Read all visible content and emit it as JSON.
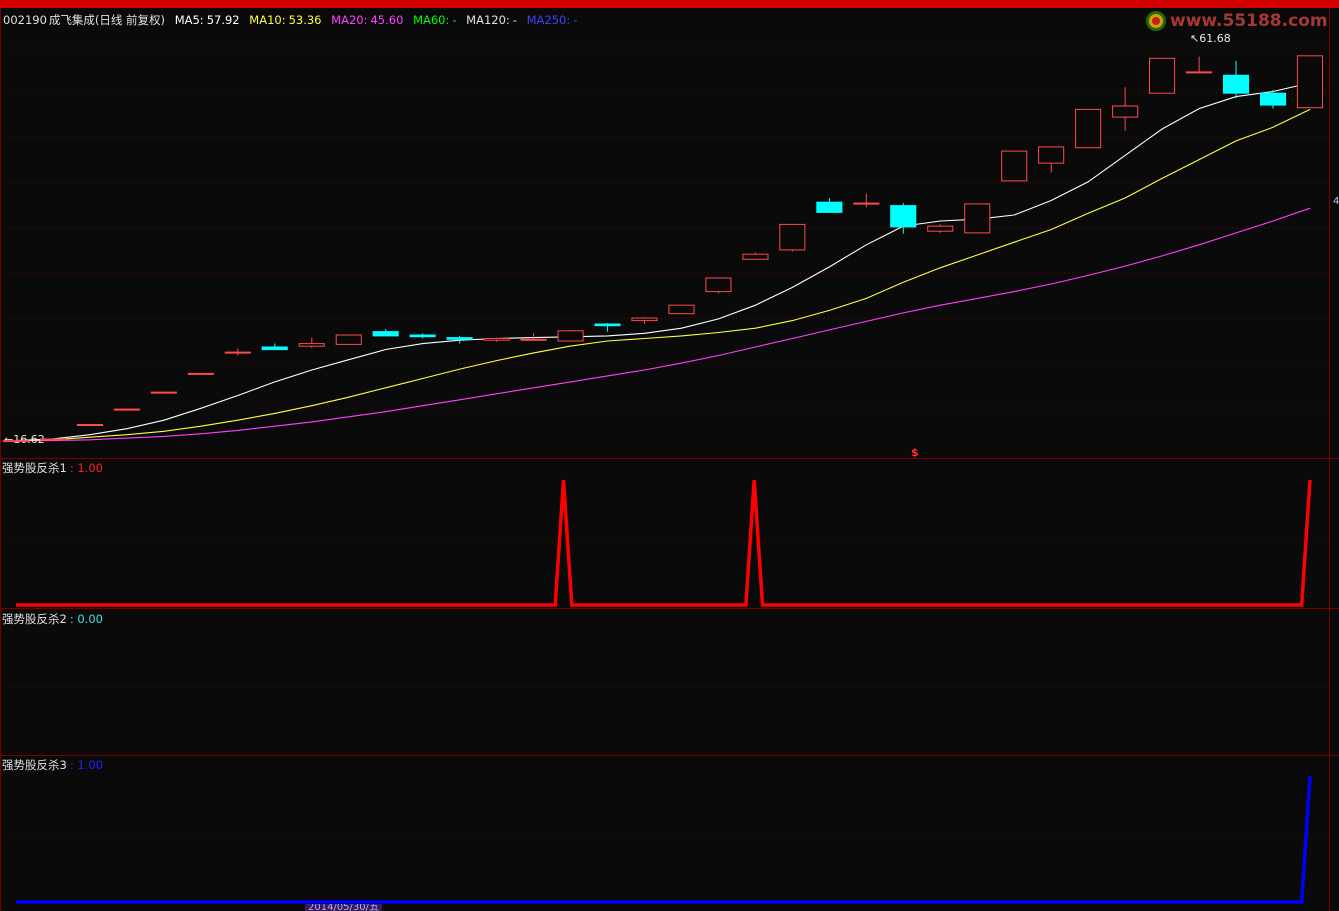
{
  "header": {
    "stock_code": "002190",
    "stock_name": "成飞集成",
    "mode": "(日线 前复权)",
    "ma5_label": "MA5:",
    "ma5_value": "57.92",
    "ma10_label": "MA10:",
    "ma10_value": "53.36",
    "ma20_label": "MA20:",
    "ma20_value": "45.60",
    "ma60_label": "MA60:",
    "ma60_value": "-",
    "ma120_label": "MA120:",
    "ma120_value": "-",
    "ma250_label": "MA250:",
    "ma250_value": "-"
  },
  "logo_text": "www.55188.com",
  "high_label": "61.68",
  "low_label": "16.62",
  "signal_mark": "$",
  "right_edge_label": "4",
  "bottom_date": "2014/05/30/五",
  "indicator1": {
    "name": "强势股反杀1",
    "value": ": 1.00"
  },
  "indicator2": {
    "name": "强势股反杀2",
    "value": ": 0.00"
  },
  "indicator3": {
    "name": "强势股反杀3",
    "value": ": 1.00"
  },
  "colors": {
    "up": "#ff4a4a",
    "down": "#00ffff",
    "ma5": "#ffffff",
    "ma10": "#ffff40",
    "ma20": "#ff40ff",
    "ma60": "#00ff00",
    "ma120": "#e0e0e0",
    "ma250": "#4040ff",
    "ind1": "#ff0000",
    "ind2": "#00ffff",
    "ind3": "#0000ff",
    "grid": "#7a0000"
  },
  "chart_data": [
    {
      "type": "candlestick",
      "ylim": [
        15.5,
        66
      ],
      "candles": [
        [
          16.6,
          16.6,
          16.6,
          16.6
        ],
        [
          16.8,
          16.8,
          16.8,
          16.8
        ],
        [
          18.5,
          18.5,
          18.5,
          18.5
        ],
        [
          20.3,
          20.3,
          20.3,
          20.3
        ],
        [
          22.3,
          22.3,
          22.3,
          22.3
        ],
        [
          24.5,
          24.5,
          24.5,
          24.5
        ],
        [
          27.0,
          27.4,
          26.6,
          27.0
        ],
        [
          27.6,
          28.0,
          27.4,
          27.3
        ],
        [
          27.7,
          28.7,
          27.5,
          28.0
        ],
        [
          27.9,
          29.0,
          27.9,
          29.0
        ],
        [
          29.4,
          29.7,
          29.0,
          28.9
        ],
        [
          29.0,
          29.2,
          28.6,
          28.8
        ],
        [
          28.7,
          28.9,
          28.0,
          28.5
        ],
        [
          28.4,
          28.7,
          28.2,
          28.6
        ],
        [
          28.5,
          29.2,
          28.4,
          28.5
        ],
        [
          28.3,
          29.6,
          28.3,
          29.5
        ],
        [
          30.3,
          30.4,
          29.4,
          30.1
        ],
        [
          30.7,
          31.1,
          30.3,
          31.0
        ],
        [
          31.5,
          32.0,
          31.5,
          32.5
        ],
        [
          34.1,
          34.5,
          33.9,
          35.7
        ],
        [
          37.9,
          38.7,
          37.9,
          38.5
        ],
        [
          39.0,
          41.0,
          38.8,
          42.0
        ],
        [
          44.6,
          45.1,
          43.4,
          43.4
        ],
        [
          44.5,
          45.6,
          44.0,
          44.5
        ],
        [
          44.2,
          44.5,
          40.9,
          41.7
        ],
        [
          41.2,
          42.0,
          41.0,
          41.8
        ],
        [
          41.0,
          44.4,
          41.0,
          44.4
        ],
        [
          47.1,
          50.6,
          47.1,
          50.6
        ],
        [
          49.2,
          51.0,
          48.1,
          51.1
        ],
        [
          51.0,
          53.1,
          51.0,
          55.5
        ],
        [
          54.6,
          58.1,
          53.0,
          55.9
        ],
        [
          57.4,
          57.5,
          58.0,
          61.5
        ],
        [
          59.9,
          61.7,
          59.9,
          59.9
        ],
        [
          59.5,
          61.2,
          56.8,
          57.4
        ],
        [
          57.4,
          57.8,
          55.6,
          56.0
        ],
        [
          55.7,
          61.8,
          55.7,
          61.8
        ]
      ],
      "ma5": [
        16.6,
        16.8,
        17.3,
        18.0,
        19.0,
        20.4,
        21.9,
        23.5,
        24.9,
        26.1,
        27.3,
        28.0,
        28.4,
        28.6,
        28.7,
        28.8,
        28.9,
        29.2,
        29.8,
        30.9,
        32.5,
        34.6,
        37.0,
        39.6,
        41.8,
        42.4,
        42.6,
        43.1,
        44.8,
        47.0,
        50.1,
        53.2,
        55.6,
        57.0,
        57.6,
        58.6
      ],
      "ma10": [
        16.6,
        16.7,
        17.0,
        17.3,
        17.7,
        18.3,
        19.0,
        19.8,
        20.7,
        21.7,
        22.8,
        23.9,
        25.0,
        26.0,
        26.9,
        27.7,
        28.3,
        28.6,
        28.9,
        29.3,
        29.8,
        30.7,
        31.9,
        33.3,
        35.2,
        36.9,
        38.4,
        39.9,
        41.4,
        43.3,
        45.1,
        47.4,
        49.6,
        51.8,
        53.4,
        55.5
      ],
      "ma20": [
        16.6,
        16.6,
        16.7,
        16.9,
        17.1,
        17.4,
        17.8,
        18.3,
        18.8,
        19.4,
        20.0,
        20.7,
        21.4,
        22.1,
        22.8,
        23.5,
        24.2,
        24.9,
        25.7,
        26.6,
        27.6,
        28.6,
        29.6,
        30.6,
        31.6,
        32.5,
        33.3,
        34.1,
        35.0,
        36.0,
        37.1,
        38.3,
        39.6,
        41.0,
        42.4,
        43.9
      ]
    },
    {
      "type": "line",
      "title": "强势股反杀1",
      "ylim": [
        0,
        1
      ],
      "values": [
        0,
        0,
        0,
        0,
        0,
        0,
        0,
        0,
        0,
        0,
        0,
        0,
        0,
        0,
        0,
        0,
        0,
        0,
        0,
        0,
        0,
        0,
        0,
        0,
        0,
        0,
        0,
        0,
        0,
        0,
        0,
        0,
        0,
        0,
        0,
        0,
        0,
        0,
        0,
        0,
        0,
        0,
        0,
        0,
        0,
        0,
        0,
        0,
        0,
        0,
        0,
        0,
        0,
        0,
        0,
        0,
        0,
        0,
        0,
        0,
        0,
        0,
        0,
        0,
        0,
        0,
        1,
        0,
        0,
        0,
        0,
        0,
        0,
        0,
        0,
        0,
        0,
        0,
        0,
        0,
        0,
        0,
        0,
        0,
        0,
        0,
        0,
        0,
        0,
        1,
        0,
        0,
        0,
        0,
        0,
        0,
        0,
        0,
        0,
        0,
        0,
        0,
        0,
        0,
        0,
        0,
        0,
        0,
        0,
        0,
        0,
        0,
        0,
        0,
        0,
        0,
        0,
        0,
        0,
        0,
        0,
        0,
        0,
        0,
        0,
        0,
        0,
        0,
        0,
        0,
        0,
        0,
        0,
        0,
        0,
        0,
        0,
        0,
        0,
        0,
        0,
        0,
        0,
        0,
        0,
        0,
        0,
        0,
        0,
        0,
        0,
        0,
        0,
        0,
        0,
        0,
        1
      ]
    },
    {
      "type": "line",
      "title": "强势股反杀2",
      "ylim": [
        0,
        1
      ],
      "values": []
    },
    {
      "type": "line",
      "title": "强势股反杀3",
      "ylim": [
        0,
        1
      ],
      "values": [
        0,
        0,
        0,
        0,
        0,
        0,
        0,
        0,
        0,
        0,
        0,
        0,
        0,
        0,
        0,
        0,
        0,
        0,
        0,
        0,
        0,
        0,
        0,
        0,
        0,
        0,
        0,
        0,
        0,
        0,
        0,
        0,
        0,
        0,
        0,
        0,
        0,
        0,
        0,
        0,
        0,
        0,
        0,
        0,
        0,
        0,
        0,
        0,
        0,
        0,
        0,
        0,
        0,
        0,
        0,
        0,
        0,
        0,
        0,
        0,
        0,
        0,
        0,
        0,
        0,
        0,
        0,
        0,
        0,
        0,
        0,
        0,
        0,
        0,
        0,
        0,
        0,
        0,
        0,
        0,
        0,
        0,
        0,
        0,
        0,
        0,
        0,
        0,
        0,
        0,
        0,
        0,
        0,
        0,
        0,
        0,
        0,
        0,
        0,
        0,
        0,
        0,
        0,
        0,
        0,
        0,
        0,
        0,
        0,
        0,
        0,
        0,
        0,
        0,
        0,
        0,
        0,
        0,
        0,
        0,
        0,
        0,
        0,
        0,
        0,
        0,
        0,
        0,
        0,
        0,
        0,
        0,
        0,
        0,
        0,
        0,
        0,
        0,
        0,
        0,
        0,
        0,
        0,
        0,
        0,
        0,
        0,
        0,
        0,
        0,
        0,
        0,
        0,
        0,
        0,
        0,
        1
      ]
    }
  ]
}
